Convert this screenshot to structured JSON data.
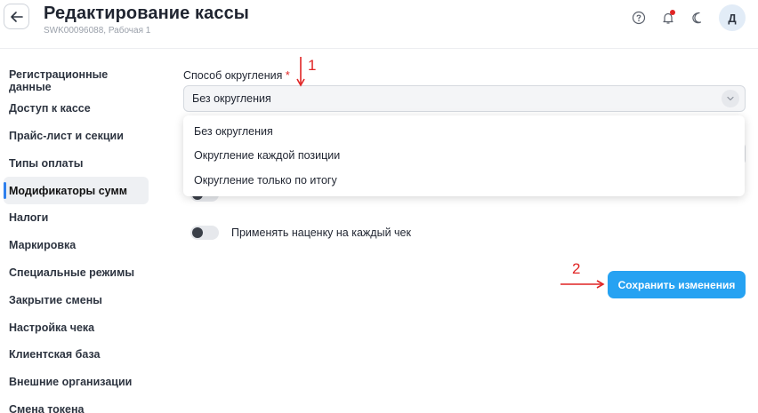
{
  "header": {
    "title": "Редактирование кассы",
    "subtitle": "SWK00096088, Рабочая 1",
    "avatar_letter": "Д",
    "icons": [
      "help-icon",
      "bell-icon",
      "moon-icon"
    ]
  },
  "sidebar": {
    "items": [
      {
        "label": "Регистрационные данные"
      },
      {
        "label": "Доступ к кассе"
      },
      {
        "label": "Прайс-лист и секции"
      },
      {
        "label": "Типы оплаты"
      },
      {
        "label": "Модификаторы сумм",
        "active": true
      },
      {
        "label": "Налоги"
      },
      {
        "label": "Маркировка"
      },
      {
        "label": "Специальные режимы"
      },
      {
        "label": "Закрытие смены"
      },
      {
        "label": "Настройка чека"
      },
      {
        "label": "Клиентская база"
      },
      {
        "label": "Внешние организации"
      },
      {
        "label": "Смена токена"
      }
    ]
  },
  "form": {
    "rounding_label": "Способ округления",
    "required_mark": "*",
    "rounding_value": "Без округления",
    "dropdown_options": [
      "Без округления",
      "Округление каждой позиции",
      "Округление только по итогу"
    ],
    "markup_toggle_label": "Применять наценку на каждый чек",
    "save_label": "Сохранить изменения"
  },
  "annotations": {
    "marker_1": "1",
    "marker_2": "2",
    "color": "#e02424"
  },
  "colors": {
    "accent": "#26a2f2",
    "active_bar": "#2f80ed",
    "required": "#e02424"
  }
}
